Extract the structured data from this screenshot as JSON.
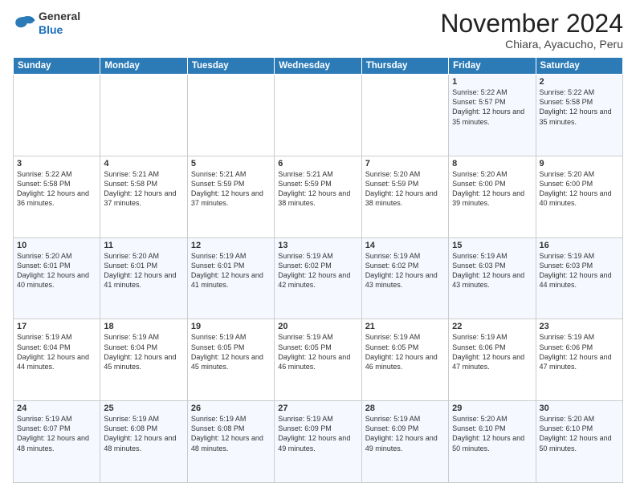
{
  "logo": {
    "general": "General",
    "blue": "Blue"
  },
  "title": "November 2024",
  "subtitle": "Chiara, Ayacucho, Peru",
  "days_of_week": [
    "Sunday",
    "Monday",
    "Tuesday",
    "Wednesday",
    "Thursday",
    "Friday",
    "Saturday"
  ],
  "weeks": [
    [
      {
        "day": "",
        "info": ""
      },
      {
        "day": "",
        "info": ""
      },
      {
        "day": "",
        "info": ""
      },
      {
        "day": "",
        "info": ""
      },
      {
        "day": "",
        "info": ""
      },
      {
        "day": "1",
        "info": "Sunrise: 5:22 AM\nSunset: 5:57 PM\nDaylight: 12 hours\nand 35 minutes."
      },
      {
        "day": "2",
        "info": "Sunrise: 5:22 AM\nSunset: 5:58 PM\nDaylight: 12 hours\nand 35 minutes."
      }
    ],
    [
      {
        "day": "3",
        "info": "Sunrise: 5:22 AM\nSunset: 5:58 PM\nDaylight: 12 hours\nand 36 minutes."
      },
      {
        "day": "4",
        "info": "Sunrise: 5:21 AM\nSunset: 5:58 PM\nDaylight: 12 hours\nand 37 minutes."
      },
      {
        "day": "5",
        "info": "Sunrise: 5:21 AM\nSunset: 5:59 PM\nDaylight: 12 hours\nand 37 minutes."
      },
      {
        "day": "6",
        "info": "Sunrise: 5:21 AM\nSunset: 5:59 PM\nDaylight: 12 hours\nand 38 minutes."
      },
      {
        "day": "7",
        "info": "Sunrise: 5:20 AM\nSunset: 5:59 PM\nDaylight: 12 hours\nand 38 minutes."
      },
      {
        "day": "8",
        "info": "Sunrise: 5:20 AM\nSunset: 6:00 PM\nDaylight: 12 hours\nand 39 minutes."
      },
      {
        "day": "9",
        "info": "Sunrise: 5:20 AM\nSunset: 6:00 PM\nDaylight: 12 hours\nand 40 minutes."
      }
    ],
    [
      {
        "day": "10",
        "info": "Sunrise: 5:20 AM\nSunset: 6:01 PM\nDaylight: 12 hours\nand 40 minutes."
      },
      {
        "day": "11",
        "info": "Sunrise: 5:20 AM\nSunset: 6:01 PM\nDaylight: 12 hours\nand 41 minutes."
      },
      {
        "day": "12",
        "info": "Sunrise: 5:19 AM\nSunset: 6:01 PM\nDaylight: 12 hours\nand 41 minutes."
      },
      {
        "day": "13",
        "info": "Sunrise: 5:19 AM\nSunset: 6:02 PM\nDaylight: 12 hours\nand 42 minutes."
      },
      {
        "day": "14",
        "info": "Sunrise: 5:19 AM\nSunset: 6:02 PM\nDaylight: 12 hours\nand 43 minutes."
      },
      {
        "day": "15",
        "info": "Sunrise: 5:19 AM\nSunset: 6:03 PM\nDaylight: 12 hours\nand 43 minutes."
      },
      {
        "day": "16",
        "info": "Sunrise: 5:19 AM\nSunset: 6:03 PM\nDaylight: 12 hours\nand 44 minutes."
      }
    ],
    [
      {
        "day": "17",
        "info": "Sunrise: 5:19 AM\nSunset: 6:04 PM\nDaylight: 12 hours\nand 44 minutes."
      },
      {
        "day": "18",
        "info": "Sunrise: 5:19 AM\nSunset: 6:04 PM\nDaylight: 12 hours\nand 45 minutes."
      },
      {
        "day": "19",
        "info": "Sunrise: 5:19 AM\nSunset: 6:05 PM\nDaylight: 12 hours\nand 45 minutes."
      },
      {
        "day": "20",
        "info": "Sunrise: 5:19 AM\nSunset: 6:05 PM\nDaylight: 12 hours\nand 46 minutes."
      },
      {
        "day": "21",
        "info": "Sunrise: 5:19 AM\nSunset: 6:05 PM\nDaylight: 12 hours\nand 46 minutes."
      },
      {
        "day": "22",
        "info": "Sunrise: 5:19 AM\nSunset: 6:06 PM\nDaylight: 12 hours\nand 47 minutes."
      },
      {
        "day": "23",
        "info": "Sunrise: 5:19 AM\nSunset: 6:06 PM\nDaylight: 12 hours\nand 47 minutes."
      }
    ],
    [
      {
        "day": "24",
        "info": "Sunrise: 5:19 AM\nSunset: 6:07 PM\nDaylight: 12 hours\nand 48 minutes."
      },
      {
        "day": "25",
        "info": "Sunrise: 5:19 AM\nSunset: 6:08 PM\nDaylight: 12 hours\nand 48 minutes."
      },
      {
        "day": "26",
        "info": "Sunrise: 5:19 AM\nSunset: 6:08 PM\nDaylight: 12 hours\nand 48 minutes."
      },
      {
        "day": "27",
        "info": "Sunrise: 5:19 AM\nSunset: 6:09 PM\nDaylight: 12 hours\nand 49 minutes."
      },
      {
        "day": "28",
        "info": "Sunrise: 5:19 AM\nSunset: 6:09 PM\nDaylight: 12 hours\nand 49 minutes."
      },
      {
        "day": "29",
        "info": "Sunrise: 5:20 AM\nSunset: 6:10 PM\nDaylight: 12 hours\nand 50 minutes."
      },
      {
        "day": "30",
        "info": "Sunrise: 5:20 AM\nSunset: 6:10 PM\nDaylight: 12 hours\nand 50 minutes."
      }
    ]
  ]
}
